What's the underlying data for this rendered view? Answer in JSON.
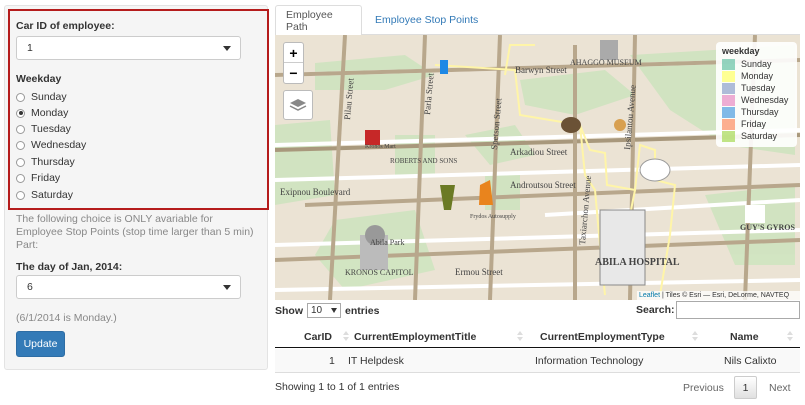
{
  "sidebar": {
    "car_id_label": "Car ID of employee:",
    "car_id_value": "1",
    "weekday_label": "Weekday",
    "weekdays": [
      {
        "label": "Sunday",
        "checked": false
      },
      {
        "label": "Monday",
        "checked": true
      },
      {
        "label": "Tuesday",
        "checked": false
      },
      {
        "label": "Wednesday",
        "checked": false
      },
      {
        "label": "Thursday",
        "checked": false
      },
      {
        "label": "Friday",
        "checked": false
      },
      {
        "label": "Saturday",
        "checked": false
      }
    ],
    "help_text": "The following choice is ONLY avariable for Employee Stop Points (stop time larger than 5 min) Part:",
    "day_label": "The day of Jan, 2014:",
    "day_value": "6",
    "day_note": "(6/1/2014 is Monday.)",
    "update_label": "Update"
  },
  "tabs": [
    {
      "label": "Employee Path",
      "active": true
    },
    {
      "label": "Employee Stop Points",
      "active": false
    }
  ],
  "map": {
    "zoom_in": "+",
    "zoom_out": "−",
    "legend_title": "weekday",
    "legend": [
      {
        "label": "Sunday",
        "color": "#66c2a5"
      },
      {
        "label": "Monday",
        "color": "#ffff66"
      },
      {
        "label": "Tuesday",
        "color": "#8da0cb"
      },
      {
        "label": "Wednesday",
        "color": "#e78ac3"
      },
      {
        "label": "Thursday",
        "color": "#4d9de0"
      },
      {
        "label": "Friday",
        "color": "#fc8d62"
      },
      {
        "label": "Saturday",
        "color": "#a6d854"
      }
    ],
    "labels": {
      "street_barwyn": "Barwyn Street",
      "street_pilau": "Pilau Street",
      "street_parla": "Parla Street",
      "street_spetson": "Spetson Street",
      "street_arkadiou": "Arkadiou Street",
      "street_androutsou": "Androutsou Street",
      "street_ermou": "Ermou Street",
      "street_taxiarchon": "Taxiarchon Avenue",
      "street_ipsilantou": "Ipsilantou Avenue",
      "street_exipnou": "Exipnou Boulevard",
      "abila_hospital": "ABILA HOSPITAL",
      "ahaggo_museum": "AHAGGO MUSEUM",
      "abila_park": "Abila Park",
      "kronos_capitol": "KRONOS CAPITOL",
      "guys_gyros": "GUY'S GYROS",
      "roberts_sons": "ROBERTS AND SONS",
      "kronos_mart": "Kronos Mart",
      "frydos_autosupply": "Frydos Autosupply"
    },
    "attrib_link": "Leaflet",
    "attrib_text": " | Tiles © Esri — Esri, DeLorme, NAVTEQ"
  },
  "table": {
    "show_label": "Show",
    "length_value": "10",
    "entries_label": "entries",
    "search_label": "Search:",
    "columns": [
      "CarID",
      "CurrentEmploymentTitle",
      "CurrentEmploymentType",
      "Name"
    ],
    "rows": [
      [
        "1",
        "IT Helpdesk",
        "Information Technology",
        "Nils Calixto"
      ]
    ],
    "info": "Showing 1 to 1 of 1 entries",
    "prev_label": "Previous",
    "page": "1",
    "next_label": "Next"
  }
}
